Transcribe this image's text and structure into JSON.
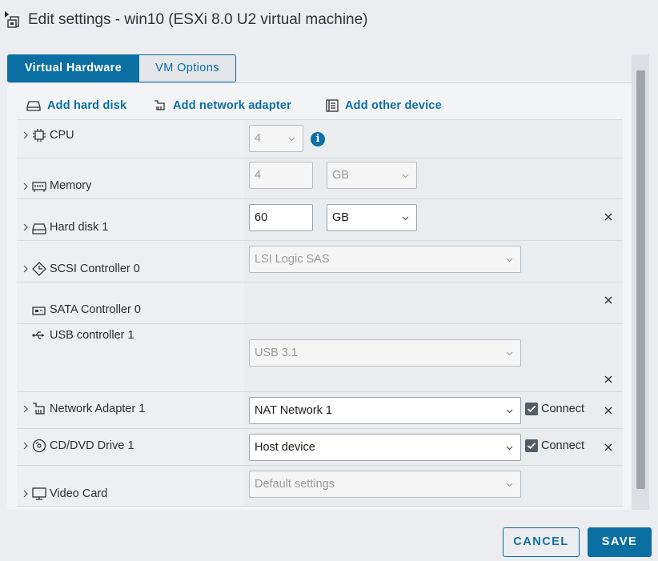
{
  "window": {
    "title": "Edit settings - win10 (ESXi 8.0 U2 virtual machine)"
  },
  "tabs": [
    {
      "label": "Virtual Hardware",
      "active": true
    },
    {
      "label": "VM Options",
      "active": false
    }
  ],
  "add_actions": {
    "hard_disk": "Add hard disk",
    "network_adapter": "Add network adapter",
    "other_device": "Add other device"
  },
  "devices": {
    "cpu": {
      "label": "CPU",
      "value": "4"
    },
    "memory": {
      "label": "Memory",
      "value": "4",
      "unit": "GB"
    },
    "hard_disk": {
      "label": "Hard disk 1",
      "value": "60",
      "unit": "GB"
    },
    "scsi": {
      "label": "SCSI Controller 0",
      "value": "LSI Logic SAS"
    },
    "sata": {
      "label": "SATA Controller 0"
    },
    "usb": {
      "label": "USB controller 1",
      "value": "USB 3.1"
    },
    "network": {
      "label": "Network Adapter 1",
      "value": "NAT Network 1",
      "connect_label": "Connect",
      "connected": true
    },
    "cdrom": {
      "label": "CD/DVD Drive 1",
      "value": "Host device",
      "connect_label": "Connect",
      "connected": true
    },
    "video": {
      "label": "Video Card",
      "value": "Default settings"
    }
  },
  "footer": {
    "cancel_label": "CANCEL",
    "save_label": "SAVE"
  },
  "colors": {
    "accent": "#0b6fa3",
    "background": "#ecedf0"
  }
}
